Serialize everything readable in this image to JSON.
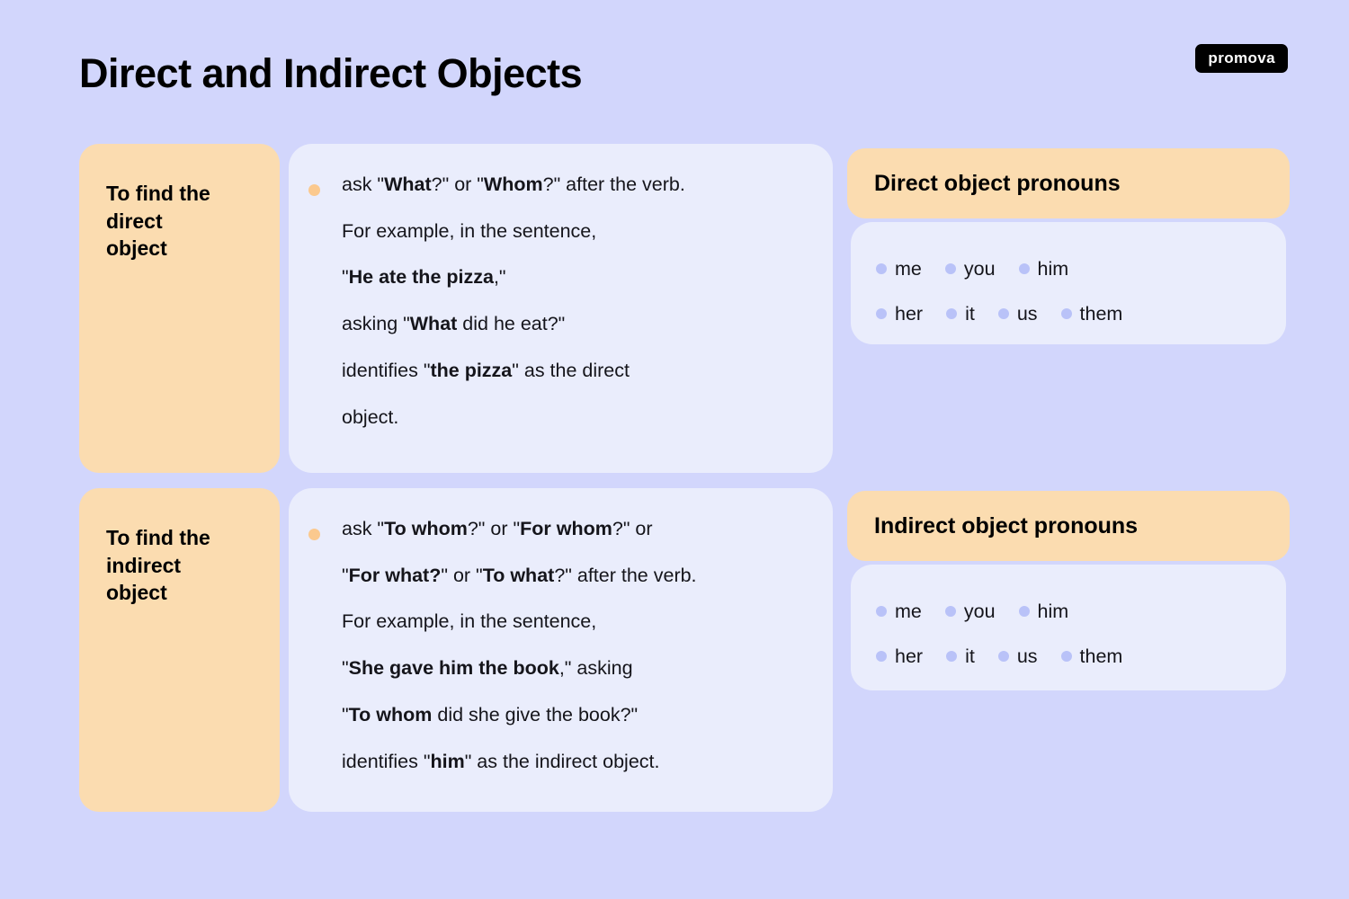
{
  "header": {
    "title": "Direct and Indirect Objects",
    "logo_text": "promova"
  },
  "colors": {
    "background": "#d2d6fc",
    "orange_card": "#fbdcb0",
    "content_card": "#eaedfc",
    "orange_bullet": "#fbc98e",
    "blue_bullet": "#b9c2f8",
    "text": "#15151b",
    "logo_background": "#000000",
    "logo_text_color": "#ffffff"
  },
  "rows": [
    {
      "label": "To find the\ndirect\nobject",
      "bullet_icon": "orange-dot-icon",
      "lines_html": [
        "ask \"<b>What</b>?\" or \"<b>Whom</b>?\" after the verb.",
        "For example, in the sentence,",
        "\"<b>He ate the pizza</b>,\"",
        "asking \"<b>What</b> did he eat?\"",
        "identifies \"<b>the pizza</b>\" as the direct",
        "object."
      ],
      "lines_text": [
        "ask \"What?\" or \"Whom?\" after the verb.",
        "For example, in the sentence,",
        "\"He ate the pizza,\"",
        "asking \"What did he eat?\"",
        "identifies \"the pizza\" as the direct",
        "object."
      ]
    },
    {
      "label": "To find the\nindirect\nobject",
      "bullet_icon": "orange-dot-icon",
      "lines_html": [
        "ask \"<b>To whom</b>?\" or \"<b>For whom</b>?\" or",
        "\"<b>For what?</b>\" or \"<b>To what</b>?\" after the verb.",
        "For example, in the sentence,",
        "\"<b>She gave him the book</b>,\" asking",
        "\"<b>To whom</b> did she give the book?\"",
        "identifies \"<b>him</b>\" as the indirect object."
      ],
      "lines_text": [
        "ask \"To whom?\" or \"For whom?\" or",
        "\"For what?\" or \"To what?\" after the verb.",
        "For example, in the sentence,",
        "\"She gave him the book,\" asking",
        "\"To whom did she give the book?\"",
        "identifies \"him\" as the indirect object."
      ]
    }
  ],
  "panels": [
    {
      "title": "Direct object pronouns",
      "pronoun_rows": [
        [
          "me",
          "you",
          "him"
        ],
        [
          "her",
          "it",
          "us",
          "them"
        ]
      ]
    },
    {
      "title": "Indirect object pronouns",
      "pronoun_rows": [
        [
          "me",
          "you",
          "him"
        ],
        [
          "her",
          "it",
          "us",
          "them"
        ]
      ]
    }
  ]
}
